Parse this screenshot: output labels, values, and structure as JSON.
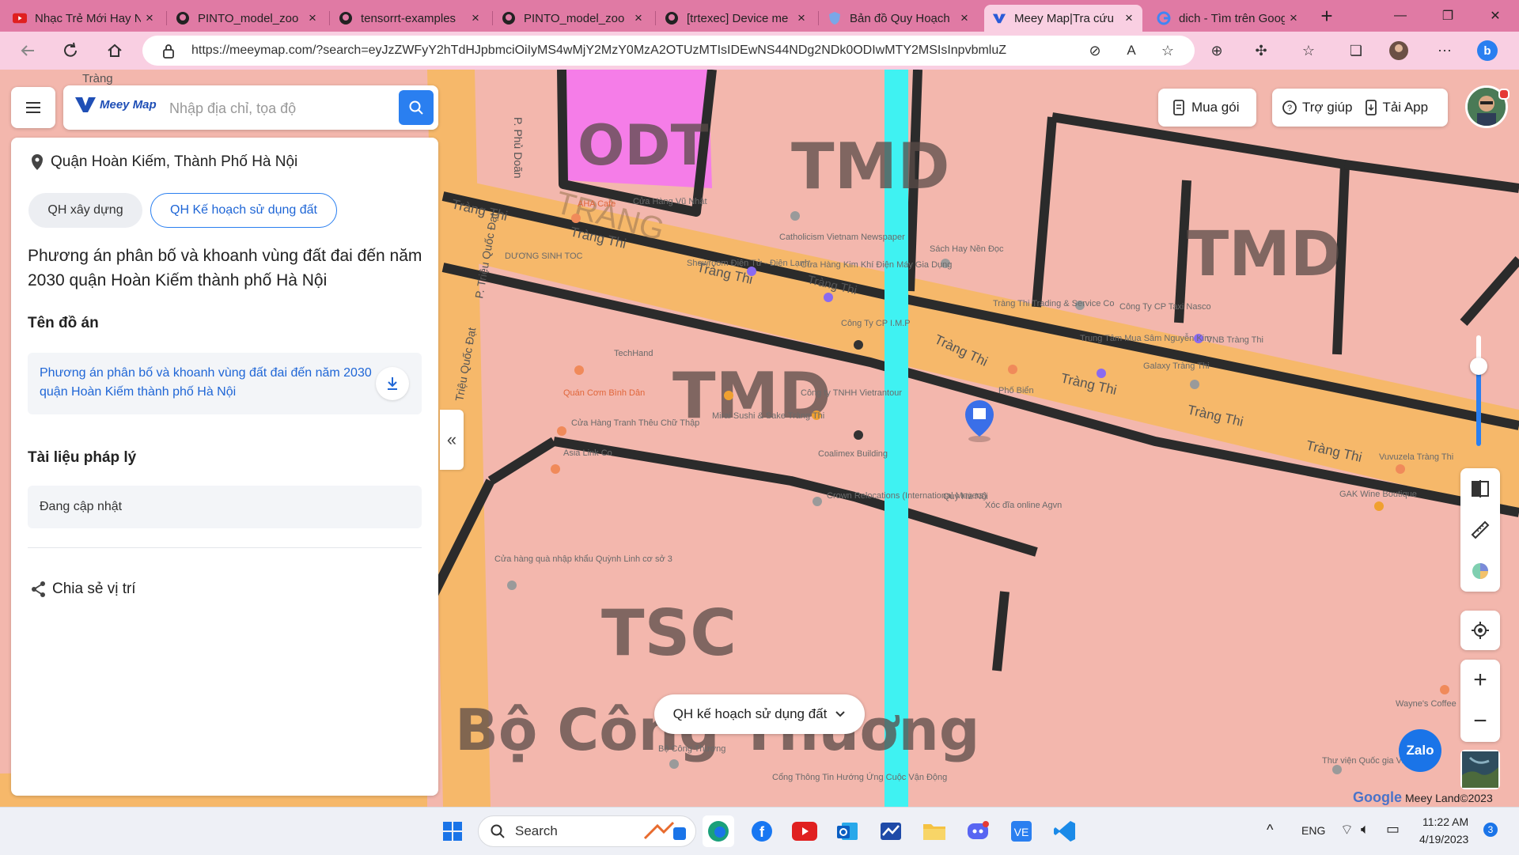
{
  "browser": {
    "tabs": [
      {
        "title": "Nhạc Trẻ Mới Hay Nhất",
        "icon": "youtube-icon"
      },
      {
        "title": "PINTO_model_zoo",
        "icon": "github-icon"
      },
      {
        "title": "tensorrt-examples",
        "icon": "github-icon"
      },
      {
        "title": "PINTO_model_zoo",
        "icon": "github-icon"
      },
      {
        "title": "[trtexec] Device me",
        "icon": "github-icon"
      },
      {
        "title": "Bản đồ Quy Hoạch",
        "icon": "shield-icon"
      },
      {
        "title": "Meey Map|Tra cứu",
        "icon": "meeymap-icon"
      },
      {
        "title": "dich - Tìm trên Google",
        "icon": "google-icon"
      }
    ],
    "active_tab_index": 6,
    "url": "https://meeymap.com/?search=eyJzZWFyY2hTdHJpbmciOiIyMS4wMjY2MzY0MzA2OTUzMTIsIDEwNS44NDg2NDk0ODIwMTY2MSIsInpvbmluZ1…"
  },
  "app": {
    "logo_text": "Meey Map",
    "search": {
      "placeholder": "Nhập địa chỉ, tọa độ",
      "value": ""
    },
    "top_buttons": {
      "buy": "Mua gói",
      "help": "Trợ giúp",
      "download": "Tải App"
    }
  },
  "panel": {
    "location": "Quận Hoàn Kiếm, Thành Phố Hà Nội",
    "chips": {
      "construction": "QH xây dựng",
      "land_use": "QH Kế hoạch sử dụng đất"
    },
    "plan_title": "Phương án phân bố và khoanh vùng đất đai đến năm 2030 quận Hoàn Kiếm thành phố Hà Nội",
    "project_label": "Tên đồ án",
    "project_link": "Phương án phân bố và khoanh vùng đất đai đến năm 2030 quận Hoàn Kiếm thành phố Hà Nội",
    "legal_label": "Tài liệu pháp lý",
    "legal_status": "Đang cập nhật",
    "share_label": "Chia sẻ vị trí"
  },
  "map": {
    "layer_selector": "QH kế hoạch sử dụng đất",
    "zone_labels": [
      "ODT",
      "TMD",
      "TMD",
      "TMD",
      "TSC",
      "Bộ Công Thương"
    ],
    "street_labels": [
      "Tràng Thi",
      "Tràng Thi",
      "Tràng Thi",
      "Tràng Thi",
      "Tràng Thi",
      "Tràng Thi",
      "Tràng Thi",
      "Tràng Thi",
      "TRÀNG",
      "P. Phủ Doãn",
      "P. Triệu Quốc Đạt",
      "Triệu Quốc Đạt",
      "Tràng"
    ],
    "poi_labels": [
      "AHA Cafe",
      "Cửa Hàng Vũ Nhật",
      "Catholicism Vietnam Newspaper",
      "Sách Hay Nền Đọc",
      "DƯƠNG SINH TOC",
      "Showroom Điện Tử - Điện Lạnh",
      "Cửa Hàng Kim Khí Điện Máy Gia Dụng",
      "Tràng Thi Trading & Service Co",
      "Công Ty CP Taxi Nasco",
      "VNB Tràng Thi",
      "Công Ty CP I.M.P",
      "Trung Tâm Mua Sâm Nguyễn Kim",
      "Galaxy Tràng Thi",
      "TechHand",
      "Quán Cơm Bình Dân",
      "Phố Biển",
      "Công ty TNHH Vietrantour",
      "Mirai Sushi & Sake Tràng Thi",
      "Cửa Hàng Tranh Thêu Chữ Thập",
      "Coalimex Building",
      "Vuvuzela Tràng Thi",
      "Asia Link Co",
      "Crown Relocations (International Movers)",
      "Quy Hà Nội",
      "Xóc đĩa online Agvn",
      "GAK Wine Boutique",
      "Cửa hàng quà nhập khẩu Quỳnh Linh cơ sở 3",
      "Bộ Công Thương",
      "Wayne's Coffee",
      "Thư viện Quốc gia Việt Nam",
      "Cổng Thông Tin Hướng Ứng Cuộc Vận Động"
    ],
    "attribution": "Meey Land©2023",
    "google_label": "Google",
    "zoom_level": 0.7
  },
  "fab": {
    "zalo": "Zalo"
  },
  "taskbar": {
    "search_label": "Search",
    "language": "ENG",
    "time": "11:22 AM",
    "date": "4/19/2023",
    "notifications": "3"
  },
  "colors": {
    "accent": "#2a7ff0",
    "tab_strip": "#e07aa4",
    "land_commercial": "#f3b7ad",
    "road": "#f6b86a",
    "residential": "#f57de8",
    "water_line": "#3ff2f2"
  }
}
